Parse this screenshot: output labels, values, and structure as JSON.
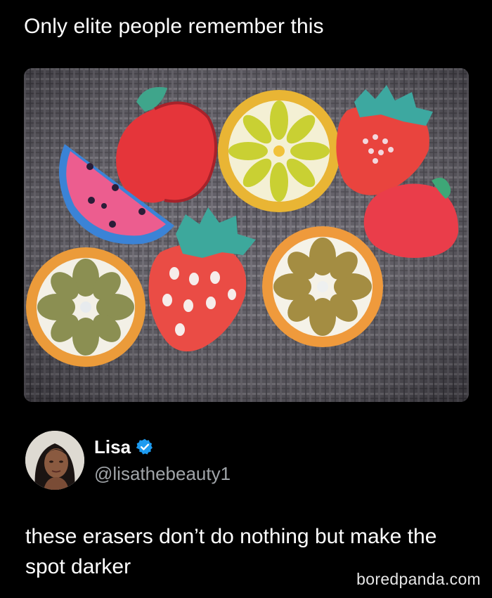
{
  "post": {
    "caption": "Only elite people remember this"
  },
  "author": {
    "display_name": "Lisa",
    "handle": "@lisathebeauty1",
    "verified": true,
    "verified_color": "#1d9bf0"
  },
  "tweet": {
    "text": "these erasers don’t do nothing but make the spot darker"
  },
  "watermark": "boredpanda.com",
  "colors": {
    "background": "#000000",
    "text": "#ffffff",
    "handle": "#a0a4a8"
  }
}
